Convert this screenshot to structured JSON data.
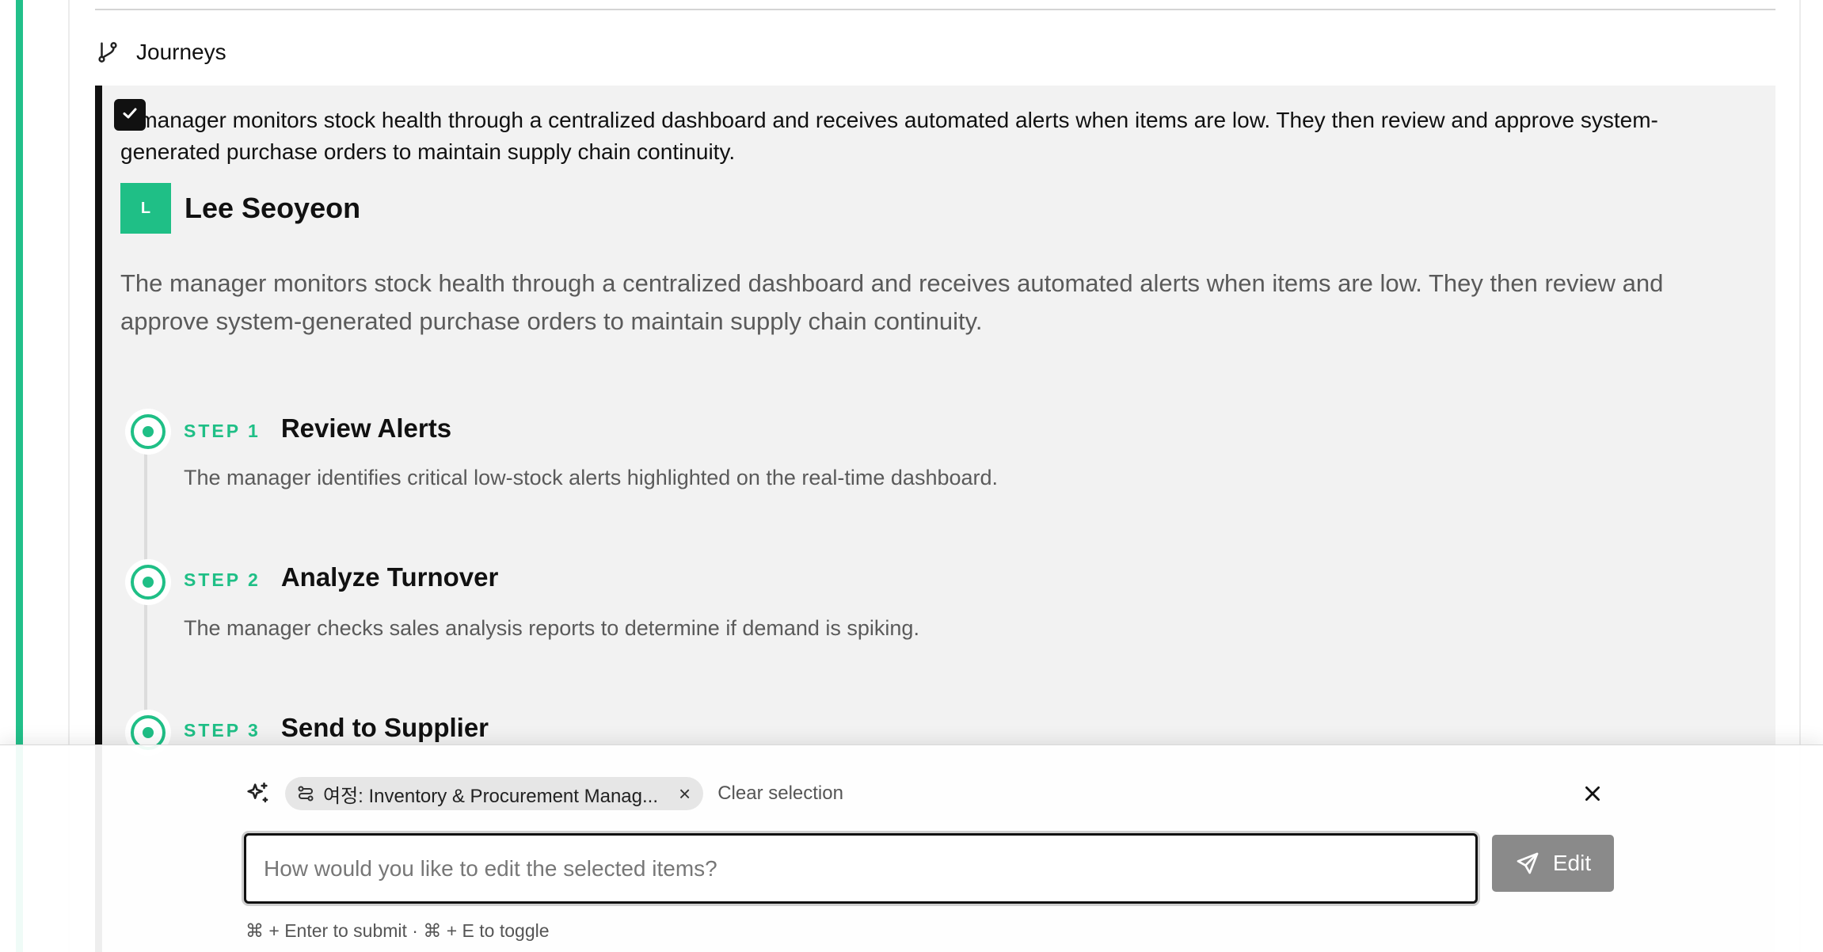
{
  "section": {
    "title": "Journeys",
    "icon": "git-branch-icon"
  },
  "journey": {
    "selected": true,
    "summary": "e manager monitors stock health through a centralized dashboard and receives automated alerts when items are low. They then review and approve system-generated purchase orders to maintain supply chain continuity.",
    "persona": {
      "initial": "L",
      "name": "Lee Seoyeon"
    },
    "description": "The manager monitors stock health through a centralized dashboard and receives automated alerts when items are low. They then review and approve system-generated purchase orders to maintain supply chain continuity.",
    "steps": [
      {
        "label": "STEP 1",
        "title": "Review Alerts",
        "description": "The manager identifies critical low-stock alerts highlighted on the real-time dashboard."
      },
      {
        "label": "STEP 2",
        "title": "Analyze Turnover",
        "description": "The manager checks sales analysis reports to determine if demand is spiking."
      },
      {
        "label": "STEP 3",
        "title": "Send to Supplier",
        "description": ""
      }
    ]
  },
  "edit_panel": {
    "chip_label": "여정: Inventory & Procurement Manag...",
    "chip_close": "×",
    "clear_selection": "Clear selection",
    "input_placeholder": "How would you like to edit the selected items?",
    "input_value": "",
    "submit_label": "Edit",
    "hint": "⌘ + Enter to submit · ⌘ + E to toggle"
  },
  "colors": {
    "accent": "#1fbf86",
    "selection_border": "#111111",
    "button_disabled": "#8a8a8a"
  }
}
